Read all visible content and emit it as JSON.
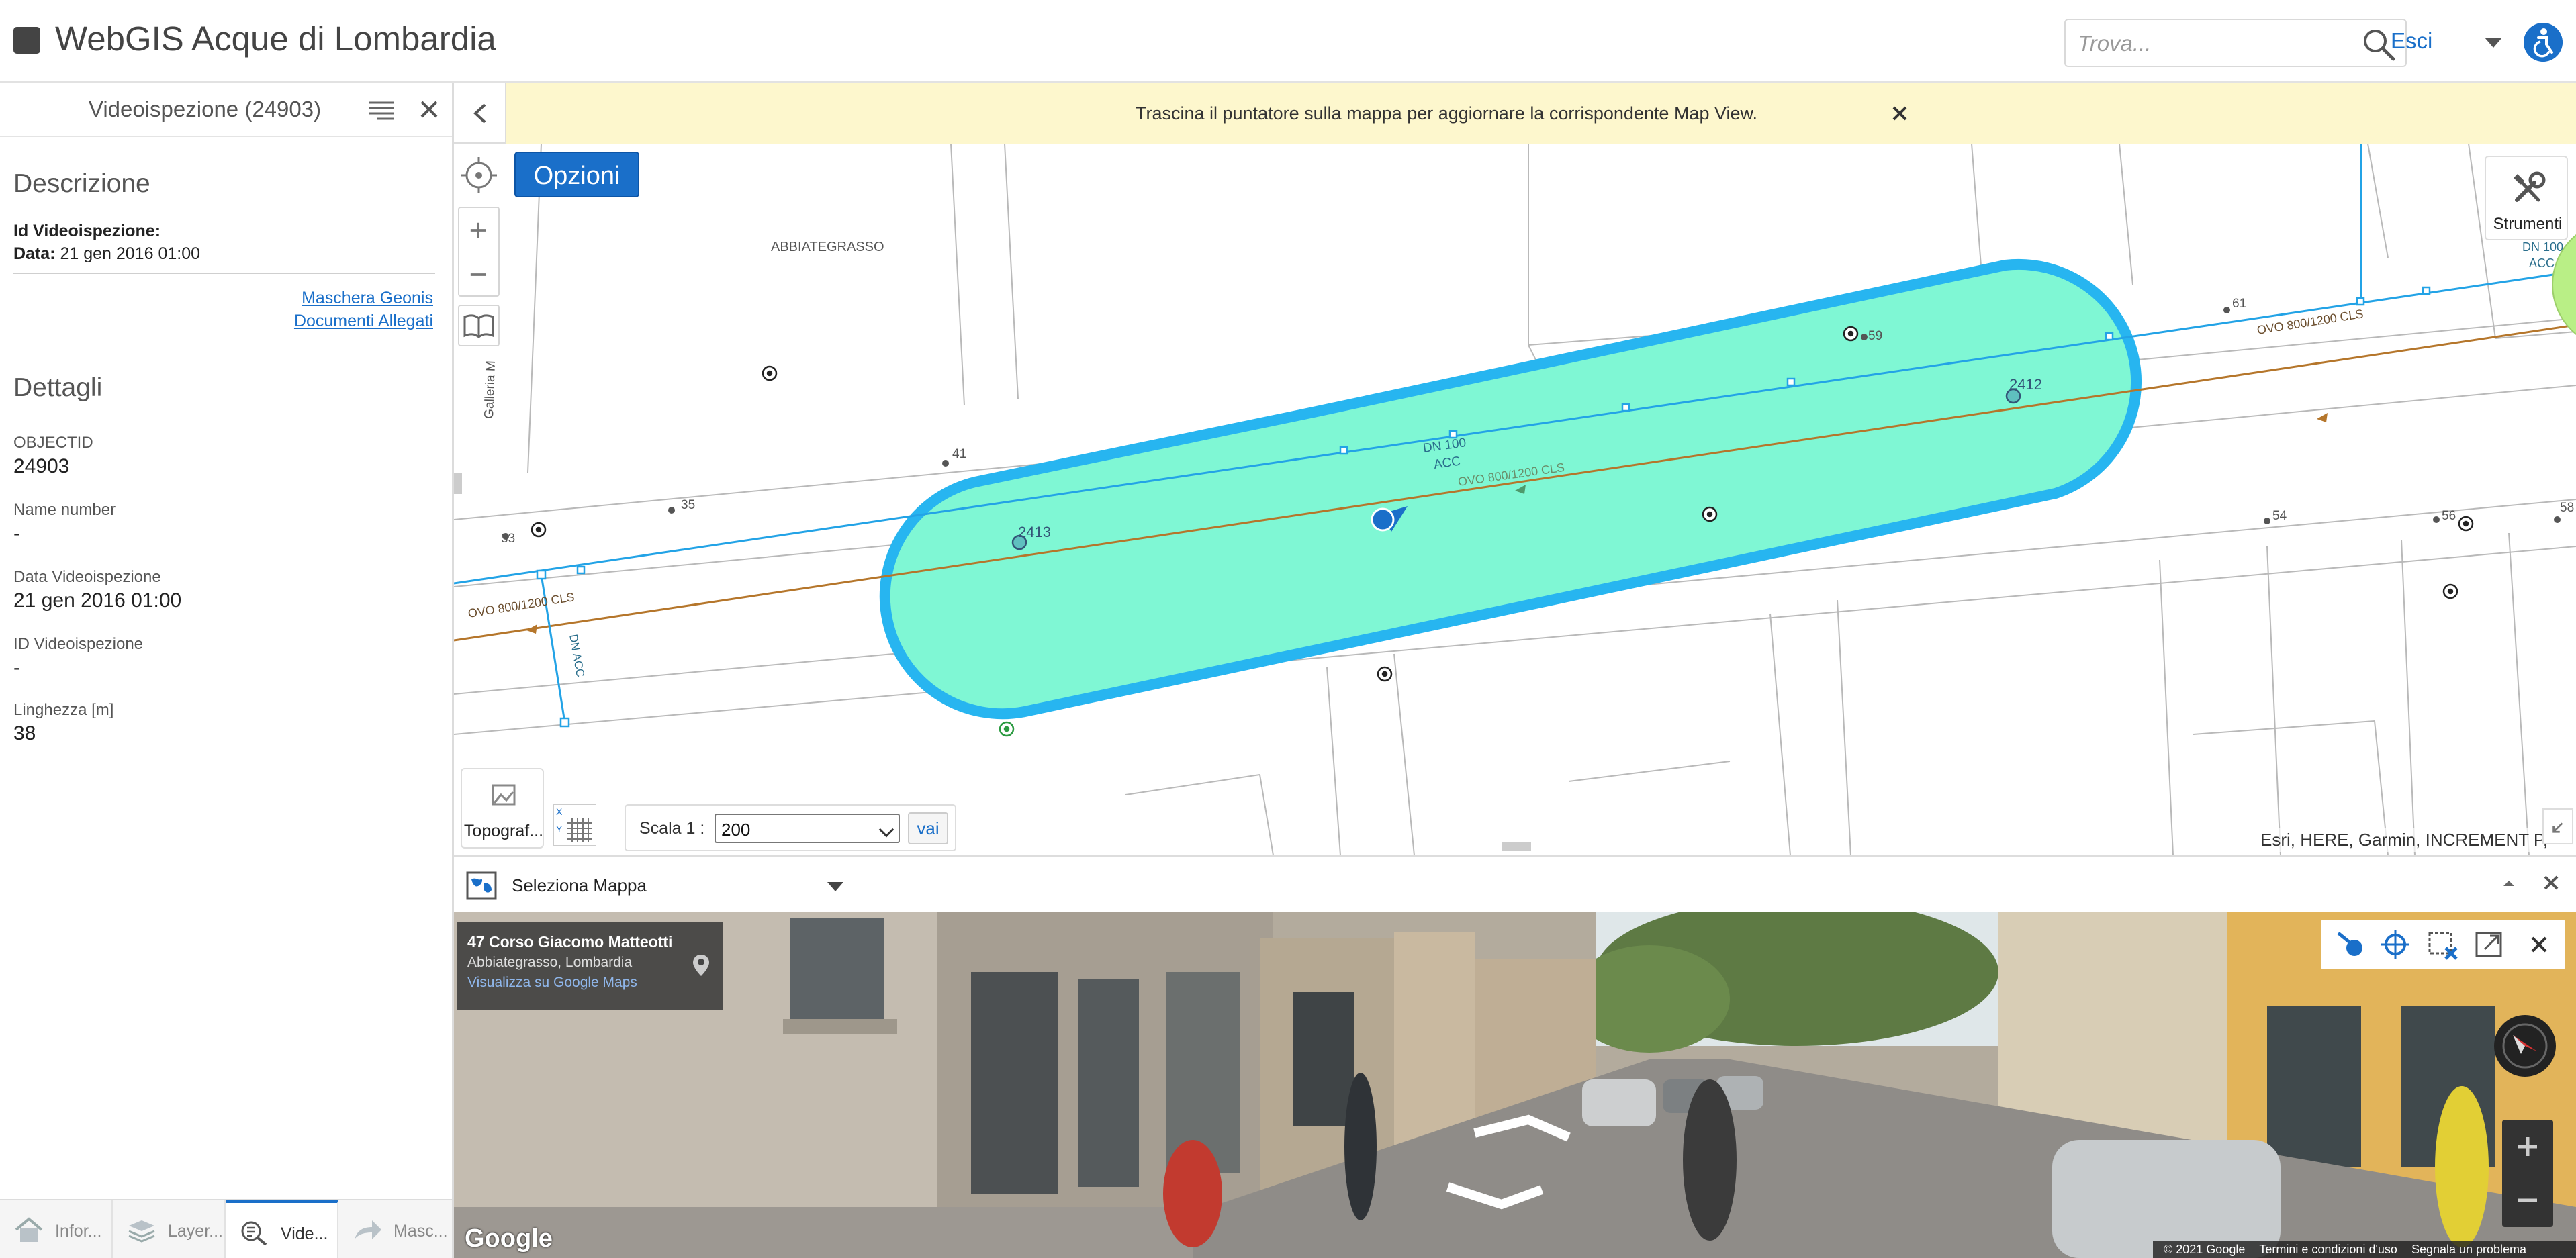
{
  "header": {
    "title": "WebGIS Acque di Lombardia",
    "search_placeholder": "Trova...",
    "logout_label": "Esci"
  },
  "panel": {
    "title": "Videoispezione (24903)",
    "description_heading": "Descrizione",
    "id_label": "Id Videoispezione:",
    "date_label": "Data:",
    "date_value": "21 gen 2016 01:00",
    "links": [
      "Maschera Geonis",
      "Documenti Allegati"
    ],
    "details_heading": "Dettagli",
    "fields": [
      {
        "label": "OBJECTID",
        "value": "24903"
      },
      {
        "label": "Name number",
        "value": "-"
      },
      {
        "label": "Data Videoispezione",
        "value": "21 gen 2016 01:00"
      },
      {
        "label": "ID Videoispezione",
        "value": "-"
      },
      {
        "label": "Linghezza [m]",
        "value": "38"
      }
    ],
    "tabs": [
      {
        "label": "Infor...",
        "icon": "home-icon"
      },
      {
        "label": "Layer...",
        "icon": "layers-icon"
      },
      {
        "label": "Vide...",
        "icon": "search-list-icon",
        "active": true
      },
      {
        "label": "Masc...",
        "icon": "share-arrow-icon"
      }
    ]
  },
  "map": {
    "notice": "Trascina il puntatore sulla mappa per aggiornare la corrispondente Map View.",
    "options_label": "Opzioni",
    "tools_label": "Strumenti",
    "basemap_label": "Topograf...",
    "scale_label": "Scala 1 :",
    "scale_value": "200",
    "go_label": "vai",
    "attribution": "Esri, HERE, Garmin, INCREMENT P,",
    "labels": {
      "place": "ABBIATEGRASSO",
      "street": "Galleria M",
      "node_left": "2413",
      "node_right": "2412",
      "pipe_top": "DN 100",
      "pipe_top2": "ACC",
      "pipe_mid": "OVO 800/1200 CLS",
      "pipe_left": "OVO 800/1200 CLS",
      "pipe_right": "OVO 800/1200 CLS",
      "pipe_corner": "DN 100",
      "pipe_corner2": "ACC",
      "pipe_vertical": "DN ACC",
      "civic": [
        "33",
        "35",
        "41",
        "59",
        "61",
        "54",
        "56",
        "58"
      ]
    }
  },
  "streetview": {
    "select_label": "Seleziona Mappa",
    "address": "47 Corso Giacomo Matteotti",
    "locality": "Abbiategrasso, Lombardia",
    "gmaps_link": "Visualizza su Google Maps",
    "google_logo": "Google",
    "footer": [
      "© 2021 Google",
      "Termini e condizioni d'uso",
      "Segnala un problema"
    ]
  },
  "colors": {
    "accent": "#1a6fc9",
    "buffer_fill": "#7ff7d4",
    "buffer_stroke": "#27b5f0",
    "pipe_brown": "#b5762b",
    "pipe_blue": "#23a3e6",
    "notice_bg": "#fdf7cd"
  }
}
